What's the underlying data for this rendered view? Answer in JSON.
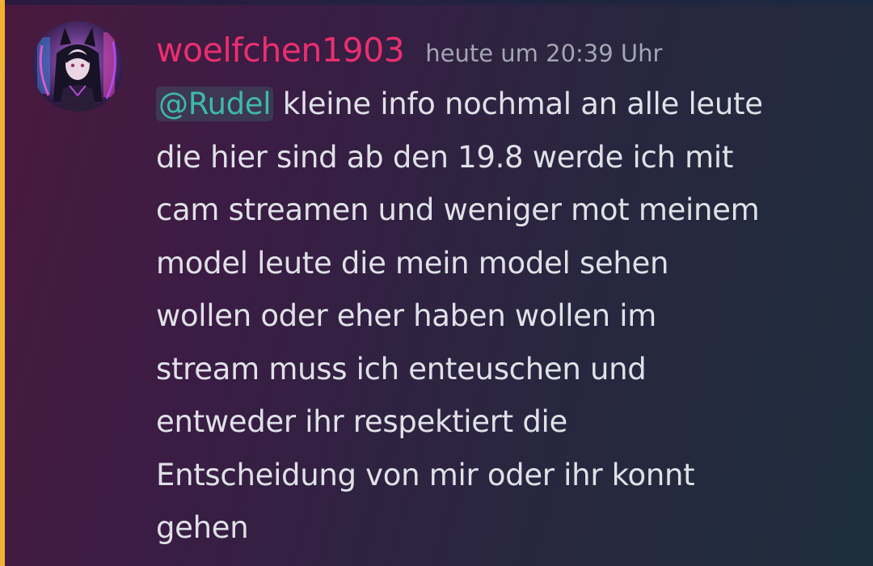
{
  "message": {
    "username": "woelfchen1903",
    "timestamp": "heute um 20:39 Uhr",
    "mention": "@Rudel",
    "first_line_text": " kleine info nochmal an alle leute",
    "lines": [
      "die hier sind ab den 19.8 werde ich mit",
      "cam streamen und weniger mot meinem",
      "model leute die mein model sehen",
      "wollen oder eher haben wollen im",
      "stream muss ich enteuschen und",
      "entweder ihr respektiert die",
      "Entscheidung von mir oder ihr konnt",
      "gehen"
    ]
  },
  "colors": {
    "username": "#ea2f6f",
    "mention": "#3fb9a6",
    "mention_bar": "#f0b232",
    "text": "#dfe1e7",
    "timestamp": "#a3a6b4"
  },
  "avatar": {
    "icon": "user-avatar-image"
  }
}
